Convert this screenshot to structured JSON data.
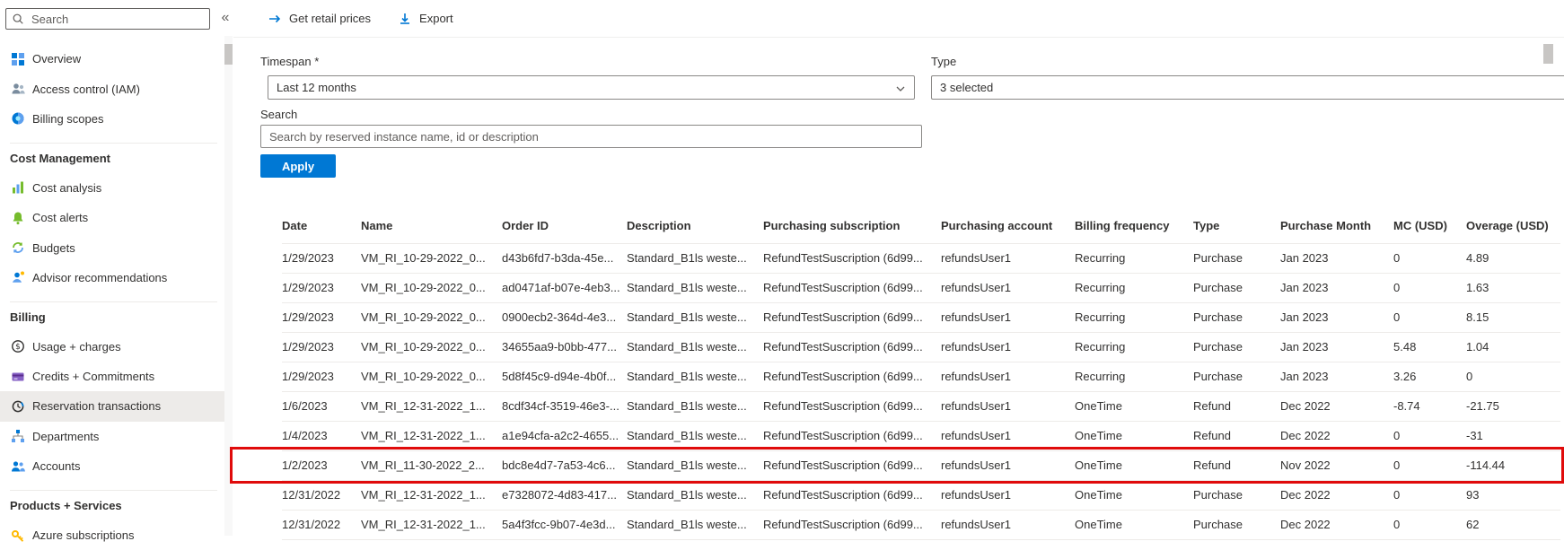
{
  "colors": {
    "accent": "#0078d4",
    "highlight_red": "#e00b0b",
    "selected_bg": "#edebe9"
  },
  "sidebar": {
    "search_placeholder": "Search",
    "collapse_icon": "«",
    "items": [
      {
        "type": "item",
        "label": "Overview",
        "icon": "overview-icon"
      },
      {
        "type": "item",
        "label": "Access control (IAM)",
        "icon": "access-control-icon"
      },
      {
        "type": "item",
        "label": "Billing scopes",
        "icon": "billing-scopes-icon"
      },
      {
        "type": "header",
        "label": "Cost Management"
      },
      {
        "type": "item",
        "label": "Cost analysis",
        "icon": "cost-analysis-icon"
      },
      {
        "type": "item",
        "label": "Cost alerts",
        "icon": "cost-alerts-icon"
      },
      {
        "type": "item",
        "label": "Budgets",
        "icon": "budgets-icon"
      },
      {
        "type": "item",
        "label": "Advisor recommendations",
        "icon": "advisor-recommendations-icon"
      },
      {
        "type": "header",
        "label": "Billing"
      },
      {
        "type": "item",
        "label": "Usage + charges",
        "icon": "usage-charges-icon"
      },
      {
        "type": "item",
        "label": "Credits + Commitments",
        "icon": "credits-commitments-icon"
      },
      {
        "type": "item",
        "label": "Reservation transactions",
        "icon": "reservation-transactions-icon",
        "selected": true
      },
      {
        "type": "item",
        "label": "Departments",
        "icon": "departments-icon"
      },
      {
        "type": "item",
        "label": "Accounts",
        "icon": "accounts-icon"
      },
      {
        "type": "header",
        "label": "Products + Services"
      },
      {
        "type": "item",
        "label": "Azure subscriptions",
        "icon": "azure-subscriptions-icon"
      }
    ]
  },
  "toolbar": {
    "get_retail_prices_label": "Get retail prices",
    "export_label": "Export"
  },
  "filters": {
    "timespan_label": "Timespan *",
    "timespan_value": "Last 12 months",
    "type_label": "Type",
    "type_value": "3 selected",
    "search_label": "Search",
    "search_placeholder": "Search by reserved instance name, id or description",
    "apply_label": "Apply"
  },
  "table": {
    "columns": [
      "Date",
      "Name",
      "Order ID",
      "Description",
      "Purchasing subscription",
      "Purchasing account",
      "Billing frequency",
      "Type",
      "Purchase Month",
      "MC (USD)",
      "Overage (USD)"
    ],
    "rows": [
      [
        "1/29/2023",
        "VM_RI_10-29-2022_0...",
        "d43b6fd7-b3da-45e...",
        "Standard_B1ls weste...",
        "RefundTestSuscription (6d99...",
        "refundsUser1",
        "Recurring",
        "Purchase",
        "Jan 2023",
        "0",
        "4.89"
      ],
      [
        "1/29/2023",
        "VM_RI_10-29-2022_0...",
        "ad0471af-b07e-4eb3...",
        "Standard_B1ls weste...",
        "RefundTestSuscription (6d99...",
        "refundsUser1",
        "Recurring",
        "Purchase",
        "Jan 2023",
        "0",
        "1.63"
      ],
      [
        "1/29/2023",
        "VM_RI_10-29-2022_0...",
        "0900ecb2-364d-4e3...",
        "Standard_B1ls weste...",
        "RefundTestSuscription (6d99...",
        "refundsUser1",
        "Recurring",
        "Purchase",
        "Jan 2023",
        "0",
        "8.15"
      ],
      [
        "1/29/2023",
        "VM_RI_10-29-2022_0...",
        "34655aa9-b0bb-477...",
        "Standard_B1ls weste...",
        "RefundTestSuscription (6d99...",
        "refundsUser1",
        "Recurring",
        "Purchase",
        "Jan 2023",
        "5.48",
        "1.04"
      ],
      [
        "1/29/2023",
        "VM_RI_10-29-2022_0...",
        "5d8f45c9-d94e-4b0f...",
        "Standard_B1ls weste...",
        "RefundTestSuscription (6d99...",
        "refundsUser1",
        "Recurring",
        "Purchase",
        "Jan 2023",
        "3.26",
        "0"
      ],
      [
        "1/6/2023",
        "VM_RI_12-31-2022_1...",
        "8cdf34cf-3519-46e3-...",
        "Standard_B1ls weste...",
        "RefundTestSuscription (6d99...",
        "refundsUser1",
        "OneTime",
        "Refund",
        "Dec 2022",
        "-8.74",
        "-21.75"
      ],
      [
        "1/4/2023",
        "VM_RI_12-31-2022_1...",
        "a1e94cfa-a2c2-4655...",
        "Standard_B1ls weste...",
        "RefundTestSuscription (6d99...",
        "refundsUser1",
        "OneTime",
        "Refund",
        "Dec 2022",
        "0",
        "-31"
      ],
      [
        "1/2/2023",
        "VM_RI_11-30-2022_2...",
        "bdc8e4d7-7a53-4c6...",
        "Standard_B1ls weste...",
        "RefundTestSuscription (6d99...",
        "refundsUser1",
        "OneTime",
        "Refund",
        "Nov 2022",
        "0",
        "-114.44"
      ],
      [
        "12/31/2022",
        "VM_RI_12-31-2022_1...",
        "e7328072-4d83-417...",
        "Standard_B1ls weste...",
        "RefundTestSuscription (6d99...",
        "refundsUser1",
        "OneTime",
        "Purchase",
        "Dec 2022",
        "0",
        "93"
      ],
      [
        "12/31/2022",
        "VM_RI_12-31-2022_1...",
        "5a4f3fcc-9b07-4e3d...",
        "Standard_B1ls weste...",
        "RefundTestSuscription (6d99...",
        "refundsUser1",
        "OneTime",
        "Purchase",
        "Dec 2022",
        "0",
        "62"
      ]
    ],
    "highlighted_row_index": 7
  }
}
